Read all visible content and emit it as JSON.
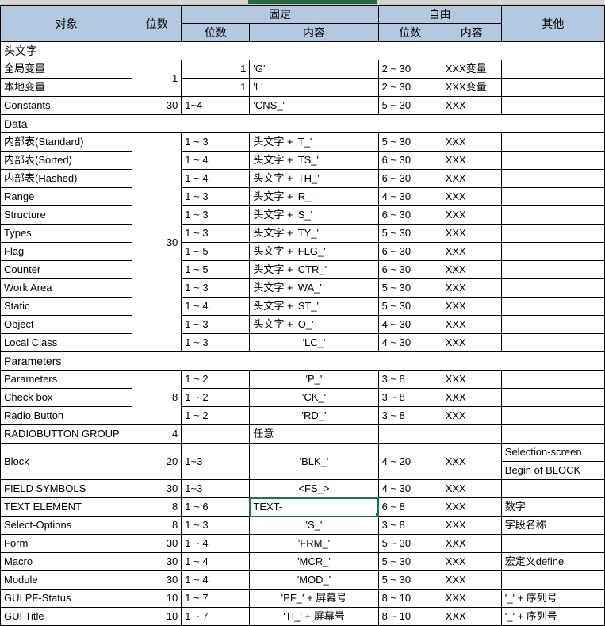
{
  "header": {
    "object": "对象",
    "digits": "位数",
    "fixed": "固定",
    "fixed_digits": "位数",
    "fixed_content": "内容",
    "free": "自由",
    "free_digits": "位数",
    "free_content": "内容",
    "other": "其他"
  },
  "sections": [
    {
      "title": "头文字",
      "group_digits": [
        {
          "value": "1",
          "span": 2
        },
        {
          "value": "",
          "span": 0
        }
      ],
      "rows": [
        {
          "object": "全局变量",
          "digits": "",
          "fixed_digits": "1",
          "fixed_content": "'G'",
          "free_digits": "2 ~ 30",
          "free_content": "XXX变量",
          "other": ""
        },
        {
          "object": "本地变量",
          "digits": "",
          "fixed_digits": "1",
          "fixed_content": "'L'",
          "free_digits": "2 ~ 30",
          "free_content": "XXX变量",
          "other": ""
        },
        {
          "object": "Constants",
          "digits": "30",
          "fixed_digits": "1~4",
          "fixed_content": "'CNS_'",
          "free_digits": "5 ~ 30",
          "free_content": "XXX",
          "other": ""
        }
      ]
    },
    {
      "title": "Data",
      "merged_digits": "30",
      "rows": [
        {
          "object": "内部表(Standard)",
          "fixed_digits": "1 ~ 3",
          "fixed_content": "头文字 +  'T_'",
          "free_digits": "5 ~ 30",
          "free_content": "XXX",
          "other": ""
        },
        {
          "object": "内部表(Sorted)",
          "fixed_digits": "1 ~ 4",
          "fixed_content": "头文字 +  'TS_'",
          "free_digits": "6 ~ 30",
          "free_content": "XXX",
          "other": ""
        },
        {
          "object": "内部表(Hashed)",
          "fixed_digits": "1 ~ 4",
          "fixed_content": "头文字 +  'TH_'",
          "free_digits": "6 ~ 30",
          "free_content": "XXX",
          "other": ""
        },
        {
          "object": "Range",
          "fixed_digits": "1 ~ 3",
          "fixed_content": "头文字 +  'R_'",
          "free_digits": "4 ~ 30",
          "free_content": "XXX",
          "other": ""
        },
        {
          "object": "Structure",
          "fixed_digits": "1 ~ 3",
          "fixed_content": "头文字 +  'S_'",
          "free_digits": "6 ~ 30",
          "free_content": "XXX",
          "other": ""
        },
        {
          "object": "Types",
          "fixed_digits": "1 ~ 3",
          "fixed_content": "头文字 +  'TY_'",
          "free_digits": "5 ~ 30",
          "free_content": "XXX",
          "other": ""
        },
        {
          "object": "Flag",
          "fixed_digits": "1 ~ 5",
          "fixed_content": "头文字 +  'FLG_'",
          "free_digits": "6 ~ 30",
          "free_content": "XXX",
          "other": ""
        },
        {
          "object": "Counter",
          "fixed_digits": "1 ~ 5",
          "fixed_content": "头文字 +  'CTR_'",
          "free_digits": "6 ~ 30",
          "free_content": "XXX",
          "other": ""
        },
        {
          "object": "Work Area",
          "fixed_digits": "1 ~ 3",
          "fixed_content": "头文字 +  'WA_'",
          "free_digits": "5 ~ 30",
          "free_content": "XXX",
          "other": ""
        },
        {
          "object": "Static",
          "fixed_digits": "1 ~ 4",
          "fixed_content": "头文字 +  'ST_'",
          "free_digits": "5 ~ 30",
          "free_content": "XXX",
          "other": ""
        },
        {
          "object": "Object",
          "fixed_digits": "1 ~ 3",
          "fixed_content": "头文字 +  'O_'",
          "free_digits": "4 ~ 30",
          "free_content": "XXX",
          "other": ""
        },
        {
          "object": "Local Class",
          "fixed_digits": "1 ~ 3",
          "fixed_content": "'LC_'",
          "free_digits": "4 ~ 30",
          "free_content": "XXX",
          "other": ""
        }
      ]
    },
    {
      "title": "Parameters",
      "merged_digits": "8",
      "rows": [
        {
          "object": "Parameters",
          "fixed_digits": "1 ~ 2",
          "fixed_content": "'P_'",
          "free_digits": "3 ~ 8",
          "free_content": "XXX",
          "other": ""
        },
        {
          "object": "Check box",
          "fixed_digits": "1 ~ 2",
          "fixed_content": "'CK_'",
          "free_digits": "3 ~ 8",
          "free_content": "XXX",
          "other": ""
        },
        {
          "object": "Radio Button",
          "fixed_digits": "1 ~ 2",
          "fixed_content": "'RD_'",
          "free_digits": "3 ~ 8",
          "free_content": "XXX",
          "other": ""
        }
      ]
    }
  ],
  "tail_rows": [
    {
      "object": "RADIOBUTTON GROUP",
      "digits": "4",
      "fixed_digits": "",
      "fixed_content": "任意",
      "free_digits": "",
      "free_content": "",
      "other": ""
    },
    {
      "object": "Block",
      "digits": "20",
      "fixed_digits": "1~3",
      "fixed_content": "'BLK_'",
      "free_digits": "4 ~ 20",
      "free_content": "XXX",
      "other_1": "Selection-screen",
      "other_2": "Begin of BLOCK",
      "tall": true
    },
    {
      "object": "FIELD SYMBOLS",
      "digits": "30",
      "fixed_digits": "1~3",
      "fixed_content": "<FS_>",
      "free_digits": "4 ~ 30",
      "free_content": "XXX",
      "other": ""
    },
    {
      "object": "TEXT ELEMENT",
      "digits": "8",
      "fixed_digits": "1 ~ 6",
      "fixed_content": "TEXT-",
      "free_digits": "6 ~ 8",
      "free_content": "XXX",
      "other": "数字",
      "selected": true
    },
    {
      "object": "Select-Options",
      "digits": "8",
      "fixed_digits": "1 ~ 3",
      "fixed_content": "'S_'",
      "free_digits": "3 ~ 8",
      "free_content": "XXX",
      "other": "字段名称"
    },
    {
      "object": "Form",
      "digits": "30",
      "fixed_digits": "1 ~ 4",
      "fixed_content": "'FRM_'",
      "free_digits": "5 ~ 30",
      "free_content": "XXX",
      "other": ""
    },
    {
      "object": "Macro",
      "digits": "30",
      "fixed_digits": "1 ~ 4",
      "fixed_content": "'MCR_'",
      "free_digits": "5 ~ 30",
      "free_content": "XXX",
      "other": "宏定义define"
    },
    {
      "object": "Module",
      "digits": "30",
      "fixed_digits": "1 ~ 4",
      "fixed_content": "'MOD_'",
      "free_digits": "5 ~ 30",
      "free_content": "XXX",
      "other": ""
    },
    {
      "object": "GUI PF-Status",
      "digits": "10",
      "fixed_digits": "1 ~ 7",
      "fixed_content": "'PF_'  + 屏幕号",
      "free_digits": "8 ~ 10",
      "free_content": "XXX",
      "other": "'_'  + 序列号"
    },
    {
      "object": "GUI Title",
      "digits": "10",
      "fixed_digits": "1 ~ 7",
      "fixed_content": "'TI_'  + 屏幕号",
      "free_digits": "8 ~ 10",
      "free_content": "XXX",
      "other": "'_'  + 序列号"
    }
  ],
  "colors": {
    "header_bg": "#b3c9e0",
    "selection": "#217346",
    "grid": "#000000"
  }
}
